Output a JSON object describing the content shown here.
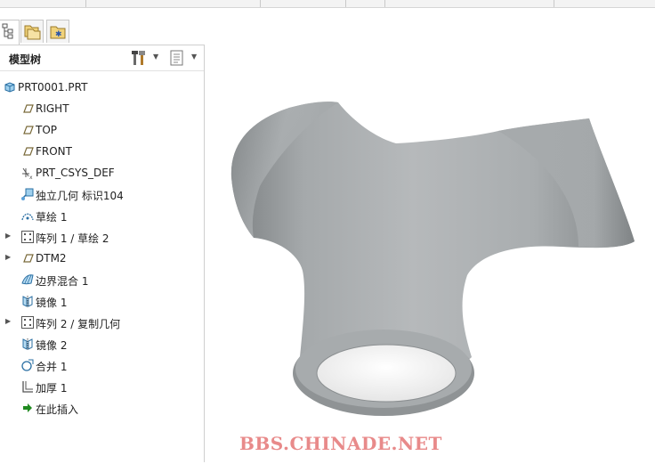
{
  "panel": {
    "title": "模型树"
  },
  "tree": {
    "items": [
      {
        "label": "PRT0001.PRT",
        "icon": "part-icon",
        "expandable": false
      },
      {
        "label": "RIGHT",
        "icon": "datum-plane-icon",
        "expandable": false
      },
      {
        "label": "TOP",
        "icon": "datum-plane-icon",
        "expandable": false
      },
      {
        "label": "FRONT",
        "icon": "datum-plane-icon",
        "expandable": false
      },
      {
        "label": "PRT_CSYS_DEF",
        "icon": "coordinate-system-icon",
        "expandable": false
      },
      {
        "label": "独立几何 标识104",
        "icon": "independent-geometry-icon",
        "expandable": false
      },
      {
        "label": "草绘 1",
        "icon": "sketch-icon",
        "expandable": false
      },
      {
        "label": "阵列 1 / 草绘 2",
        "icon": "pattern-icon",
        "expandable": true
      },
      {
        "label": "DTM2",
        "icon": "datum-plane-icon",
        "expandable": true
      },
      {
        "label": "边界混合 1",
        "icon": "boundary-blend-icon",
        "expandable": false
      },
      {
        "label": "镜像 1",
        "icon": "mirror-icon",
        "expandable": false
      },
      {
        "label": "阵列 2 / 复制几何",
        "icon": "pattern-icon",
        "expandable": true
      },
      {
        "label": "镜像 2",
        "icon": "mirror-icon",
        "expandable": false
      },
      {
        "label": "合并 1",
        "icon": "merge-icon",
        "expandable": false
      },
      {
        "label": "加厚 1",
        "icon": "thicken-icon",
        "expandable": false
      },
      {
        "label": "在此插入",
        "icon": "insert-here-arrow-icon",
        "expandable": false
      }
    ]
  },
  "watermark": "BBS.CHINADE.NET",
  "colors": {
    "insert_arrow": "#1f8a1f",
    "watermark": "#e88a8a",
    "model_body": "#a7abad"
  }
}
